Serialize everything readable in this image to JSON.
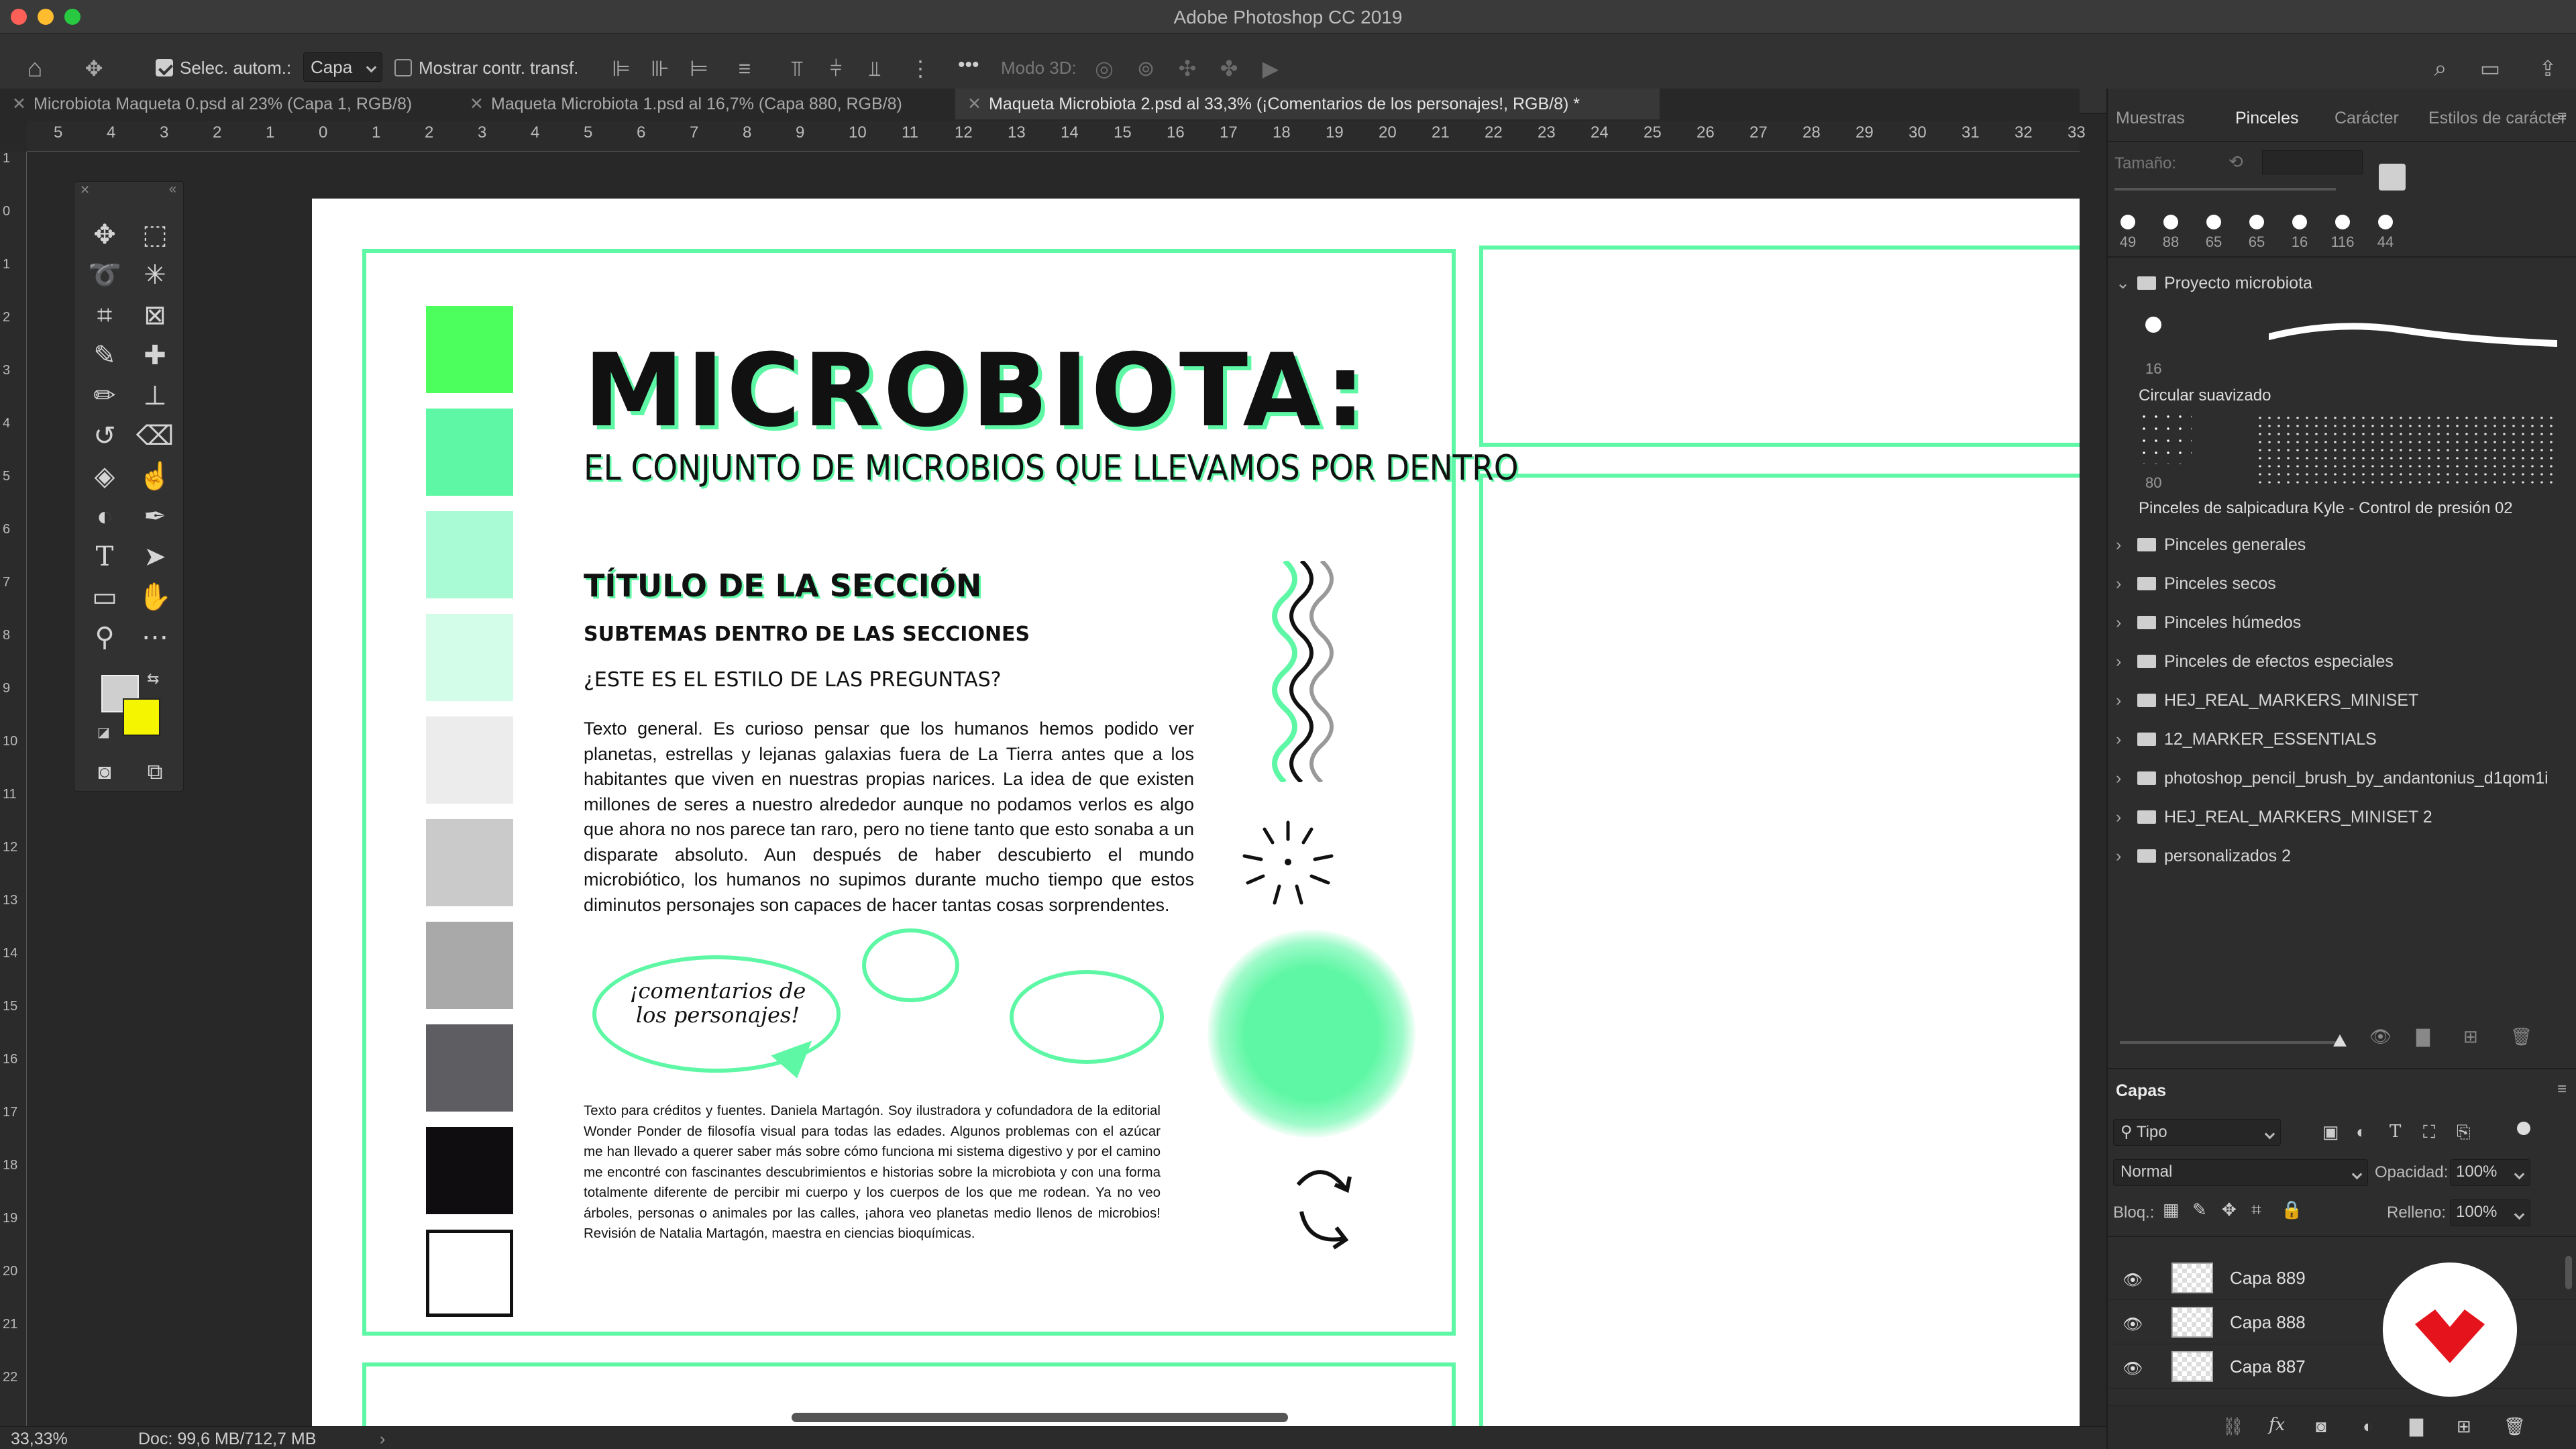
{
  "window": {
    "title": "Adobe Photoshop CC 2019"
  },
  "options_bar": {
    "auto_select_label": "Selec. autom.:",
    "auto_select_value": "Capa",
    "show_transform_label": "Mostrar contr. transf.",
    "mode3d_label": "Modo 3D:",
    "more_label": "•••"
  },
  "tabs": [
    {
      "label": "Microbiota Maqueta 0.psd al 23% (Capa 1, RGB/8)"
    },
    {
      "label": "Maqueta Microbiota 1.psd al 16,7% (Capa 880, RGB/8)"
    },
    {
      "label": "Maqueta Microbiota 2.psd al 33,3% (¡Comentarios de  los personajes!, RGB/8) *"
    }
  ],
  "ruler": {
    "h": [
      "5",
      "4",
      "3",
      "2",
      "1",
      "0",
      "1",
      "2",
      "3",
      "4",
      "5",
      "6",
      "7",
      "8",
      "9",
      "10",
      "11",
      "12",
      "13",
      "14",
      "15",
      "16",
      "17",
      "18",
      "19",
      "20",
      "21",
      "22",
      "23",
      "24",
      "25",
      "26",
      "27",
      "28",
      "29",
      "30",
      "31",
      "32",
      "33"
    ],
    "v": [
      "1",
      "0",
      "1",
      "2",
      "3",
      "4",
      "5",
      "6",
      "7",
      "8",
      "9",
      "10",
      "11",
      "12",
      "13",
      "14",
      "15",
      "16",
      "17",
      "18",
      "19",
      "20",
      "21",
      "22"
    ]
  },
  "document": {
    "title": "MICROBIOTA:",
    "subtitle": "EL CONJUNTO DE MICROBIOS QUE LLEVAMOS POR DENTRO",
    "section_title": "TÍTULO DE LA SECCIÓN",
    "subtheme": "SUBTEMAS DENTRO DE LAS SECCIONES",
    "question": "¿ESTE ES EL ESTILO DE LAS PREGUNTAS?",
    "body": "Texto general. Es curioso pensar que los humanos hemos podido ver planetas, estrellas y lejanas galaxias fuera de La Tierra antes que a los habitantes que viven en nuestras propias narices. La idea de que existen millones de seres a nuestro alrededor aunque no podamos verlos es algo que ahora no nos parece tan raro, pero no tiene tanto que esto sonaba a un disparate absoluto. Aun después de haber descubierto el mundo microbiótico, los humanos no supimos durante mucho tiempo que estos diminutos personajes son capaces de hacer tantas cosas sorprendentes.",
    "bubble_text": "¡comentarios de los personajes!",
    "credits": "Texto para créditos y fuentes. Daniela Martagón. Soy ilustradora y cofundadora de la editorial Wonder Ponder de filosofía visual para todas las edades. Algunos problemas con el azúcar me han llevado a querer saber más sobre cómo funciona mi sistema digestivo y por el camino me encontré con fascinantes descubrimientos e historias sobre la microbiota y con una forma totalmente diferente de percibir mi cuerpo y los cuerpos de los que me rodean. Ya no veo árboles, personas o animales por las calles, ¡ahora veo planetas medio llenos de microbios! Revisión de Natalia Martagón, maestra en ciencias bioquímicas.",
    "swatch_colors": [
      "#4dff5c",
      "#5ef7a5",
      "#a8fbd4",
      "#d4fde9",
      "#ececec",
      "#cacaca",
      "#a9a9a9",
      "#5e5e62",
      "#0f0d10",
      "#ffffff"
    ],
    "accent_color": "#5ef7a5"
  },
  "right_panel": {
    "tabs": [
      "Muestras",
      "Pinceles",
      "Carácter",
      "Estilos de carácter"
    ],
    "size_label": "Tamaño:",
    "recent_brush_sizes": [
      "49",
      "88",
      "65",
      "65",
      "16",
      "116",
      "44"
    ],
    "project_folder": "Proyecto microbiota",
    "brush1_size": "16",
    "brush1_name": "Circular suavizado",
    "brush2_size": "80",
    "brush2_name": "Pinceles de salpicadura Kyle - Control de presión 02",
    "folders": [
      "Pinceles generales",
      "Pinceles secos",
      "Pinceles húmedos",
      "Pinceles de efectos especiales",
      "HEJ_REAL_MARKERS_MINISET",
      "12_MARKER_ESSENTIALS",
      "photoshop_pencil_brush_by_andantonius_d1qom1i",
      "HEJ_REAL_MARKERS_MINISET  2",
      "personalizados 2"
    ]
  },
  "layers_panel": {
    "title": "Capas",
    "filter_value": "Tipo",
    "blend_mode": "Normal",
    "opacity_label": "Opacidad:",
    "opacity_value": "100%",
    "lock_label": "Bloq.:",
    "fill_label": "Relleno:",
    "fill_value": "100%",
    "layers": [
      {
        "name": "Capa 889"
      },
      {
        "name": "Capa 888"
      },
      {
        "name": "Capa 887"
      }
    ]
  },
  "status": {
    "zoom": "33,33%",
    "doc": "Doc: 99,6 MB/712,7 MB"
  }
}
